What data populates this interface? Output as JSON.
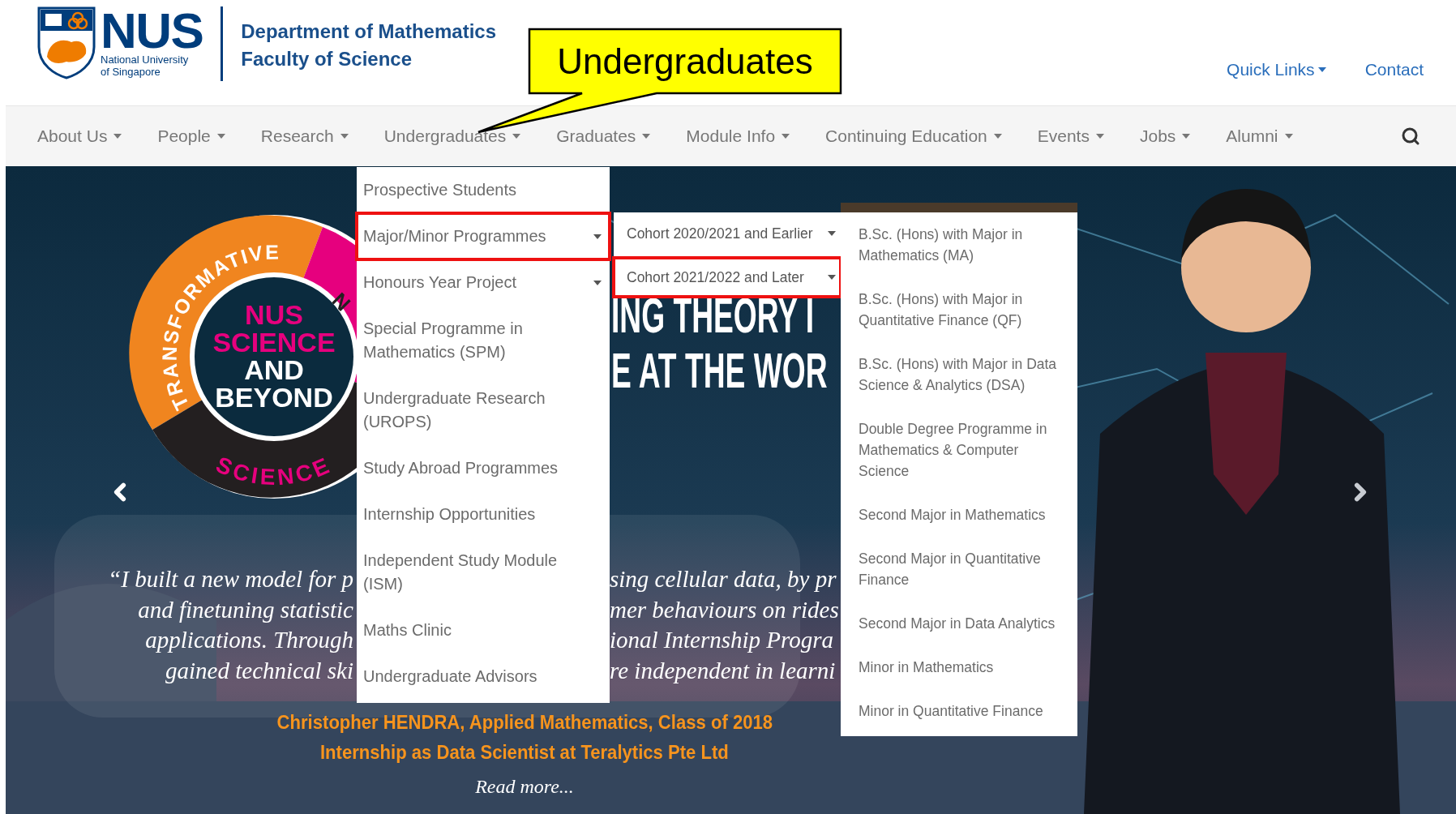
{
  "header": {
    "logo": {
      "acronym": "NUS",
      "line1": "National University",
      "line2": "of Singapore"
    },
    "department": "Department of Mathematics",
    "faculty": "Faculty of Science",
    "links": [
      {
        "label": "Quick Links",
        "caret": true
      },
      {
        "label": "Contact",
        "caret": false
      }
    ]
  },
  "callout": {
    "text": "Undergraduates"
  },
  "nav": {
    "items": [
      {
        "label": "About Us",
        "caret": true
      },
      {
        "label": "People",
        "caret": true
      },
      {
        "label": "Research",
        "caret": true
      },
      {
        "label": "Undergraduates",
        "caret": true
      },
      {
        "label": "Graduates",
        "caret": true
      },
      {
        "label": "Module Info",
        "caret": true
      },
      {
        "label": "Continuing Education",
        "caret": true
      },
      {
        "label": "Events",
        "caret": true
      },
      {
        "label": "Jobs",
        "caret": true
      },
      {
        "label": "Alumni",
        "caret": true
      }
    ]
  },
  "banner": {
    "emblem": {
      "ring_top": "TRANSFORMATIVE",
      "ring_bottom": "SCIENCE",
      "ring_right": "N",
      "center": [
        "NUS",
        "SCIENCE",
        "AND",
        "BEYOND"
      ]
    },
    "headline": [
      "ING THEORY I",
      "E AT THE WOR"
    ],
    "quote_left": [
      "“I built a new model for p",
      "and finetuning statistic",
      "applications. Through",
      "gained technical ski"
    ],
    "quote_right": [
      "sing cellular data, by pr",
      "mer behaviours on rides",
      "ional Internship Progra",
      "re independent in learni"
    ],
    "credit": [
      "Christopher HENDRA, Applied Mathematics, Class of 2018",
      "Internship as Data Scientist at Teralytics Pte Ltd"
    ],
    "read_more": "Read more..."
  },
  "menu": {
    "items": [
      {
        "label": "Prospective Students",
        "submenu": false,
        "highlighted": false
      },
      {
        "label": "Major/Minor Programmes",
        "submenu": true,
        "highlighted": true
      },
      {
        "label": "Honours Year Project",
        "submenu": true,
        "highlighted": false
      },
      {
        "label": "Special Programme in Mathematics (SPM)",
        "submenu": false,
        "highlighted": false
      },
      {
        "label": "Undergraduate Research (UROPS)",
        "submenu": false,
        "highlighted": false
      },
      {
        "label": "Study Abroad Programmes",
        "submenu": false,
        "highlighted": false
      },
      {
        "label": "Internship Opportunities",
        "submenu": false,
        "highlighted": false
      },
      {
        "label": "Independent Study Module (ISM)",
        "submenu": false,
        "highlighted": false
      },
      {
        "label": "Maths Clinic",
        "submenu": false,
        "highlighted": false
      },
      {
        "label": "Undergraduate Advisors",
        "submenu": false,
        "highlighted": false
      }
    ]
  },
  "cohort_menu": {
    "items": [
      {
        "label": "Cohort 2020/2021 and Earlier",
        "submenu": true,
        "highlighted": false
      },
      {
        "label": "Cohort 2021/2022 and Later",
        "submenu": true,
        "highlighted": true
      }
    ]
  },
  "programme_menu": {
    "items": [
      "B.Sc. (Hons) with Major in Mathematics (MA)",
      "B.Sc. (Hons) with Major in Quantitative Finance (QF)",
      "B.Sc. (Hons) with Major in Data Science & Analytics (DSA)",
      "Double Degree Programme in Mathematics & Computer Science",
      "Second Major in Mathematics",
      "Second Major in Quantitative Finance",
      "Second Major in Data Analytics",
      "Minor in Mathematics",
      "Minor in Quantitative Finance"
    ]
  }
}
